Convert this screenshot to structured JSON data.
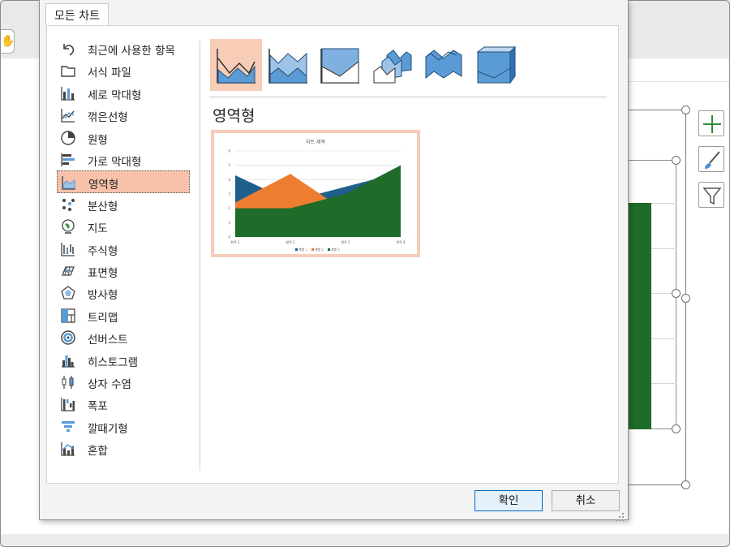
{
  "dialog": {
    "tab_label": "모든 차트",
    "section_title": "영역형",
    "ok_label": "확인",
    "cancel_label": "취소"
  },
  "nav": [
    {
      "label": "최근에 사용한 항목",
      "icon": "undo-icon"
    },
    {
      "label": "서식 파일",
      "icon": "folder-icon"
    },
    {
      "label": "세로 막대형",
      "icon": "column-chart-icon"
    },
    {
      "label": "꺾은선형",
      "icon": "line-chart-icon"
    },
    {
      "label": "원형",
      "icon": "pie-chart-icon"
    },
    {
      "label": "가로 막대형",
      "icon": "bar-chart-icon"
    },
    {
      "label": "영역형",
      "icon": "area-chart-icon",
      "selected": true
    },
    {
      "label": "분산형",
      "icon": "scatter-chart-icon"
    },
    {
      "label": "지도",
      "icon": "globe-icon"
    },
    {
      "label": "주식형",
      "icon": "stock-chart-icon"
    },
    {
      "label": "표면형",
      "icon": "surface-chart-icon"
    },
    {
      "label": "방사형",
      "icon": "radar-chart-icon"
    },
    {
      "label": "트리맵",
      "icon": "treemap-icon"
    },
    {
      "label": "선버스트",
      "icon": "sunburst-icon"
    },
    {
      "label": "히스토그램",
      "icon": "histogram-icon"
    },
    {
      "label": "상자 수염",
      "icon": "box-whisker-icon"
    },
    {
      "label": "폭포",
      "icon": "waterfall-icon"
    },
    {
      "label": "깔때기형",
      "icon": "funnel-icon"
    },
    {
      "label": "혼합",
      "icon": "combo-chart-icon"
    }
  ],
  "subtypes": [
    "area-subtype-icon",
    "stacked-area-subtype-icon",
    "100-stacked-area-subtype-icon",
    "3d-area-subtype-icon",
    "3d-stacked-area-subtype-icon",
    "3d-100-stacked-area-subtype-icon"
  ],
  "colors": {
    "selection": "#f7c2a9",
    "series1": "#1f5f8b",
    "series2": "#ed7d31",
    "series3": "#1e6b2a",
    "icon_blue": "#5b9bd5",
    "primary_border": "#0067c0"
  },
  "chart_data": {
    "type": "area",
    "title": "차트 제목",
    "categories": [
      "항목 1",
      "항목 2",
      "항목 3",
      "항목 4"
    ],
    "series": [
      {
        "name": "계열 1",
        "values": [
          4.3,
          2.5,
          3.5,
          4.5
        ]
      },
      {
        "name": "계열 2",
        "values": [
          2.4,
          4.4,
          1.8,
          2.8
        ]
      },
      {
        "name": "계열 3",
        "values": [
          2,
          2,
          3,
          5
        ]
      }
    ],
    "ylim": [
      0,
      6
    ],
    "yticks": [
      "0",
      "1",
      "2",
      "3",
      "4",
      "5",
      "6"
    ],
    "legend": "bottom",
    "grid": true
  }
}
